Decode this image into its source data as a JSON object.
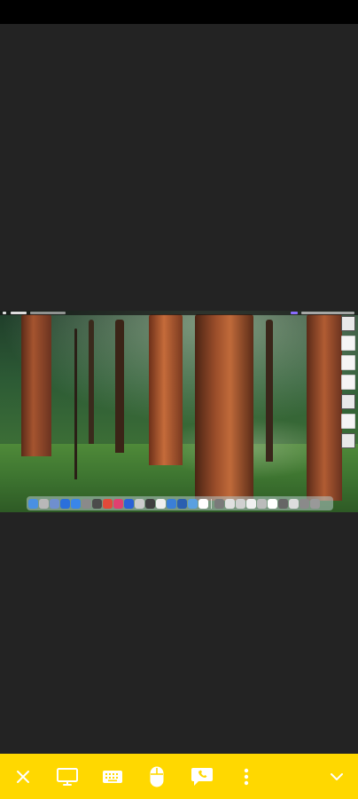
{
  "colors": {
    "toolbar_background": "#ffd800",
    "viewer_background": "#232323",
    "status_bar": "#000000"
  },
  "remote_screen": {
    "wallpaper": "sequoia forest",
    "dock_icon_colors": [
      "#4a90e2",
      "#b8b8b8",
      "#6f8fcf",
      "#2a6fdb",
      "#3a86e8",
      "#8a8a8a",
      "#4b4b4b",
      "#e24a3a",
      "#e04070",
      "#2b61d6",
      "#cccccc",
      "#3f3f3f",
      "#eeeeee",
      "#3b7fd6",
      "#2a5fb0",
      "#5aa0e0",
      "#ffffff",
      "#7a7a7a",
      "#e0e0e0",
      "#d0d0d0",
      "#f0f0f0",
      "#bbbbbb",
      "#ffffff",
      "#666666",
      "#dddddd",
      "#8a8a8a",
      "#999999"
    ]
  },
  "toolbar": {
    "buttons": [
      {
        "name": "close-icon"
      },
      {
        "name": "monitor-icon"
      },
      {
        "name": "keyboard-icon"
      },
      {
        "name": "mouse-icon"
      },
      {
        "name": "chat-phone-icon"
      },
      {
        "name": "more-vertical-icon"
      },
      {
        "name": "chevron-down-icon"
      }
    ]
  }
}
